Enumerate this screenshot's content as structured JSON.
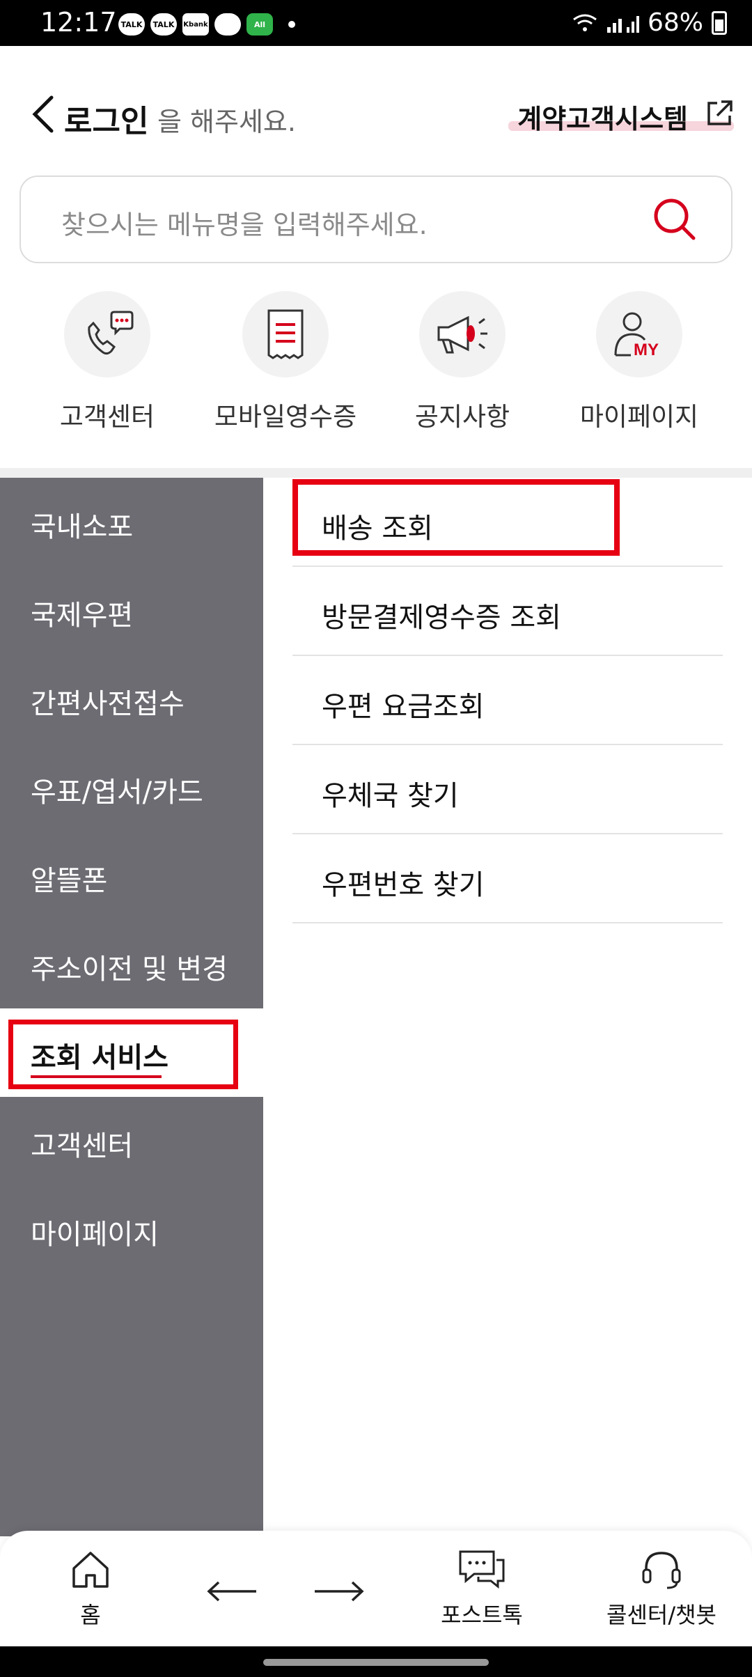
{
  "status_bar": {
    "time": "12:17",
    "apps": [
      "TALK",
      "TALK",
      "Kbank",
      "",
      "All"
    ],
    "battery": "68%"
  },
  "header": {
    "login_strong": "로그인",
    "login_rest": "을 해주세요.",
    "contract_link": "계약고객시스템"
  },
  "search": {
    "placeholder": "찾으시는 메뉴명을 입력해주세요."
  },
  "quick_menu": [
    {
      "label": "고객센터",
      "icon": "phone-chat-icon"
    },
    {
      "label": "모바일영수증",
      "icon": "receipt-icon"
    },
    {
      "label": "공지사항",
      "icon": "megaphone-icon"
    },
    {
      "label": "마이페이지",
      "icon": "my-user-icon",
      "icon_text": "MY"
    }
  ],
  "left_menu": {
    "items": [
      {
        "label": "국내소포"
      },
      {
        "label": "국제우편"
      },
      {
        "label": "간편사전접수"
      },
      {
        "label": "우표/엽서/카드"
      },
      {
        "label": "알뜰폰"
      },
      {
        "label": "주소이전 및 변경"
      },
      {
        "label": "조회 서비스",
        "active": true
      },
      {
        "label": "고객센터"
      },
      {
        "label": "마이페이지"
      }
    ]
  },
  "sub_menu": {
    "items": [
      {
        "label": "배송 조회"
      },
      {
        "label": "방문결제영수증 조회"
      },
      {
        "label": "우편 요금조회"
      },
      {
        "label": "우체국 찾기"
      },
      {
        "label": "우편번호 찾기"
      }
    ]
  },
  "bottom_nav": {
    "home": "홈",
    "posttalk": "포스트톡",
    "callcenter": "콜센터/챗봇"
  },
  "colors": {
    "accent": "#d5001c",
    "highlight_box": "#e60012",
    "menu_bg": "#6d6c73"
  }
}
